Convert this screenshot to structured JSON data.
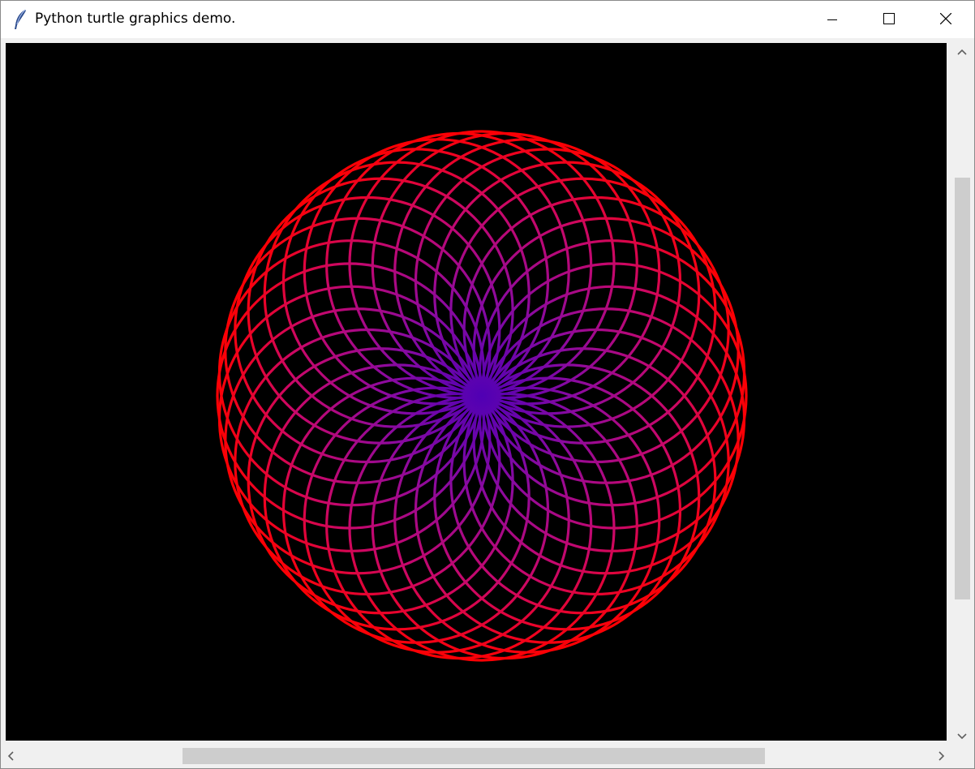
{
  "window": {
    "title": "Python turtle graphics demo.",
    "app_icon": "feather-icon",
    "controls": {
      "minimize_icon": "minimize-icon",
      "maximize_icon": "maximize-icon",
      "close_icon": "close-icon"
    }
  },
  "canvas": {
    "background": "#000000",
    "drawing": "spirograph-rosette",
    "circle_count": 36,
    "outer_color": "#ff0000",
    "inner_color": "#5000b4"
  },
  "scrollbars": {
    "vertical": {
      "up_icon": "chevron-up-icon",
      "down_icon": "chevron-down-icon",
      "thumb_start_fraction": 0.19,
      "thumb_size_fraction": 0.6
    },
    "horizontal": {
      "left_icon": "chevron-left-icon",
      "right_icon": "chevron-right-icon",
      "thumb_start_fraction": 0.19,
      "thumb_size_fraction": 0.61
    }
  }
}
